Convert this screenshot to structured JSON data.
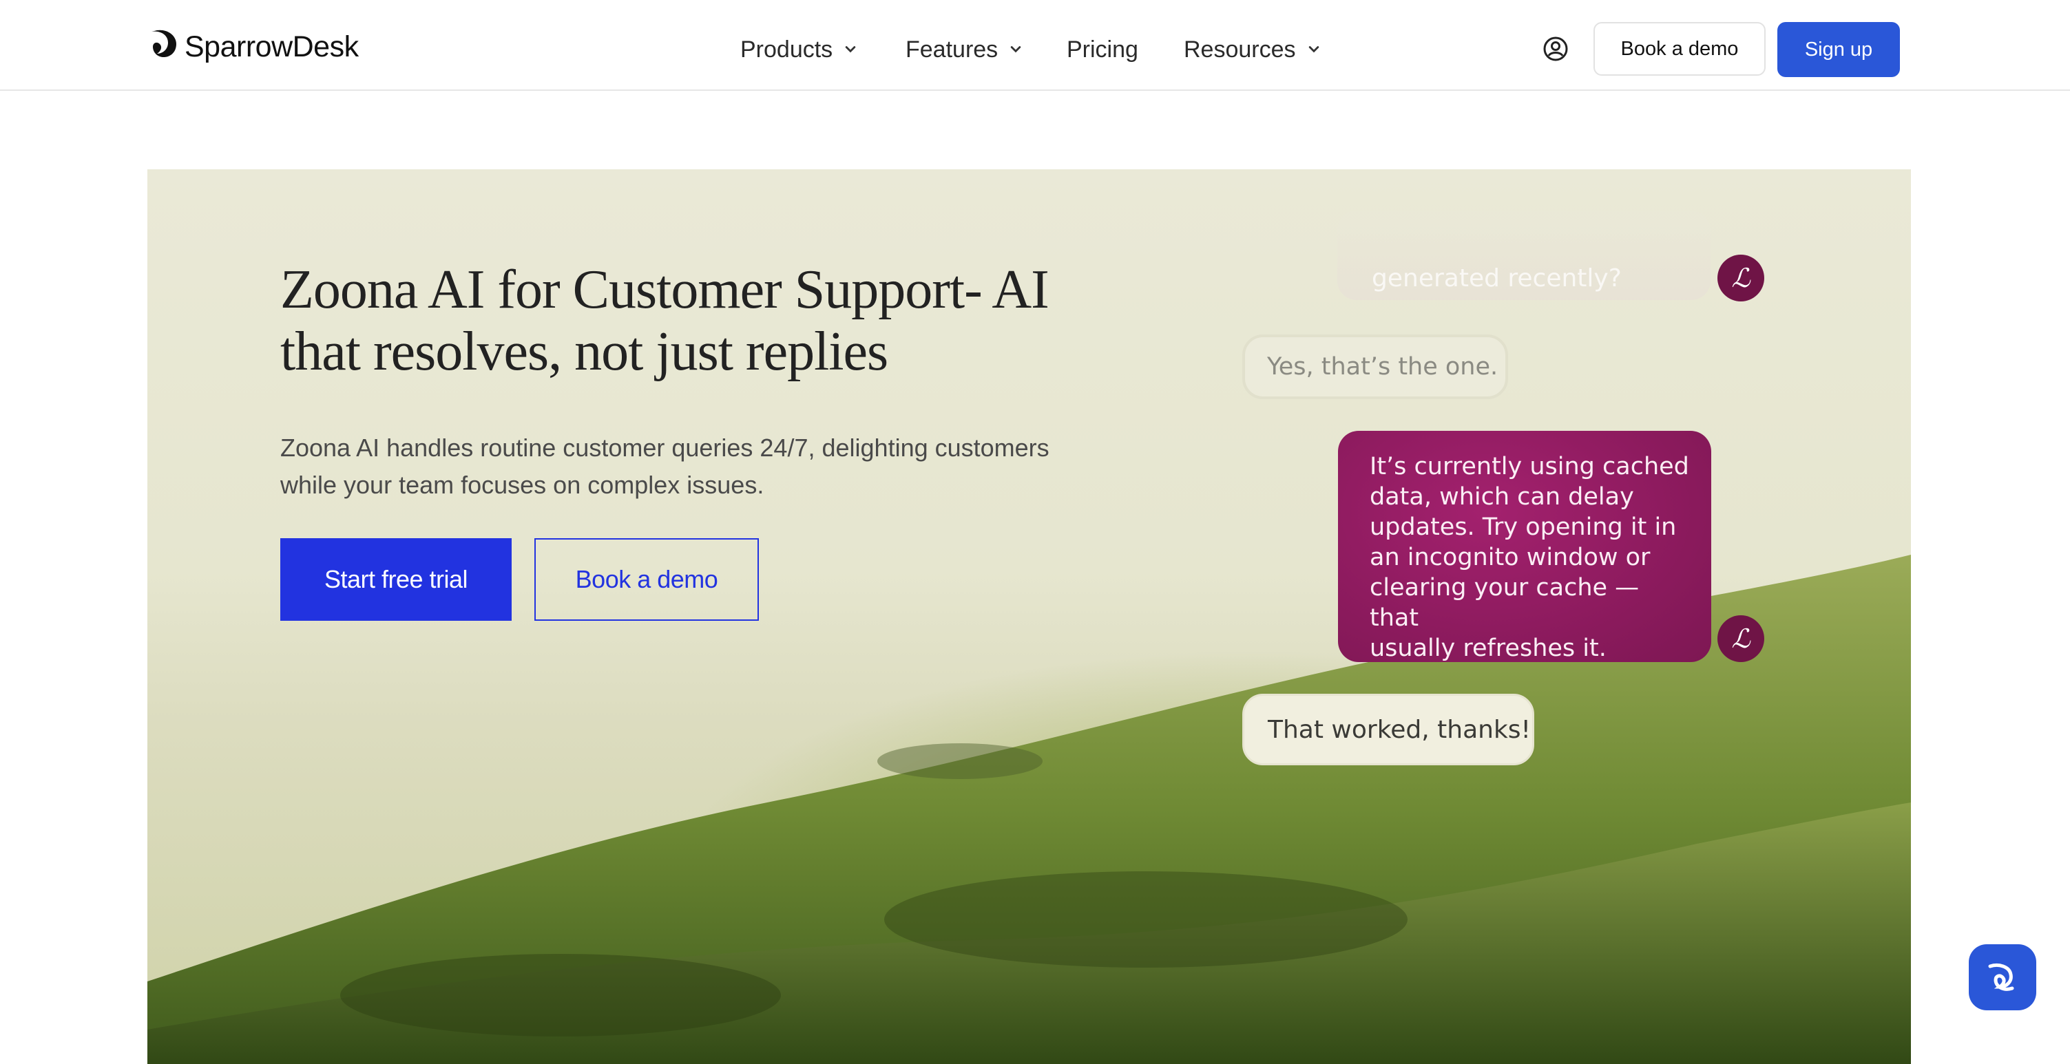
{
  "header": {
    "logo_text": "SparrowDesk",
    "nav": {
      "products": "Products",
      "features": "Features",
      "pricing": "Pricing",
      "resources": "Resources"
    },
    "book_demo": "Book a demo",
    "sign_up": "Sign up"
  },
  "hero": {
    "title_line1": "Zoona AI for Customer Support- AI",
    "title_line2": "that resolves, not just replies",
    "sub_line1": "Zoona AI handles routine customer queries 24/7, delighting customers",
    "sub_line2": "while your team focuses on complex issues.",
    "cta_trial": "Start free trial",
    "cta_demo": "Book a demo"
  },
  "chat": {
    "faded_message": "generated recently?",
    "user_message_1": "Yes, that’s the one.",
    "agent_lines": [
      "It’s currently using cached",
      "data, which can delay",
      "updates. Try opening it in",
      "an incognito window or",
      "clearing your cache — that",
      "usually refreshes it."
    ],
    "user_message_2": "That worked, thanks!",
    "avatar_glyph": "ℒ"
  },
  "colors": {
    "brand_blue": "#2a57d8",
    "cta_blue": "#2233e0",
    "agent_bubble": "#8e1b5f"
  },
  "icons": [
    "sparrowdesk-logo-icon",
    "chevron-down-icon",
    "account-icon",
    "chat-launcher-icon"
  ]
}
